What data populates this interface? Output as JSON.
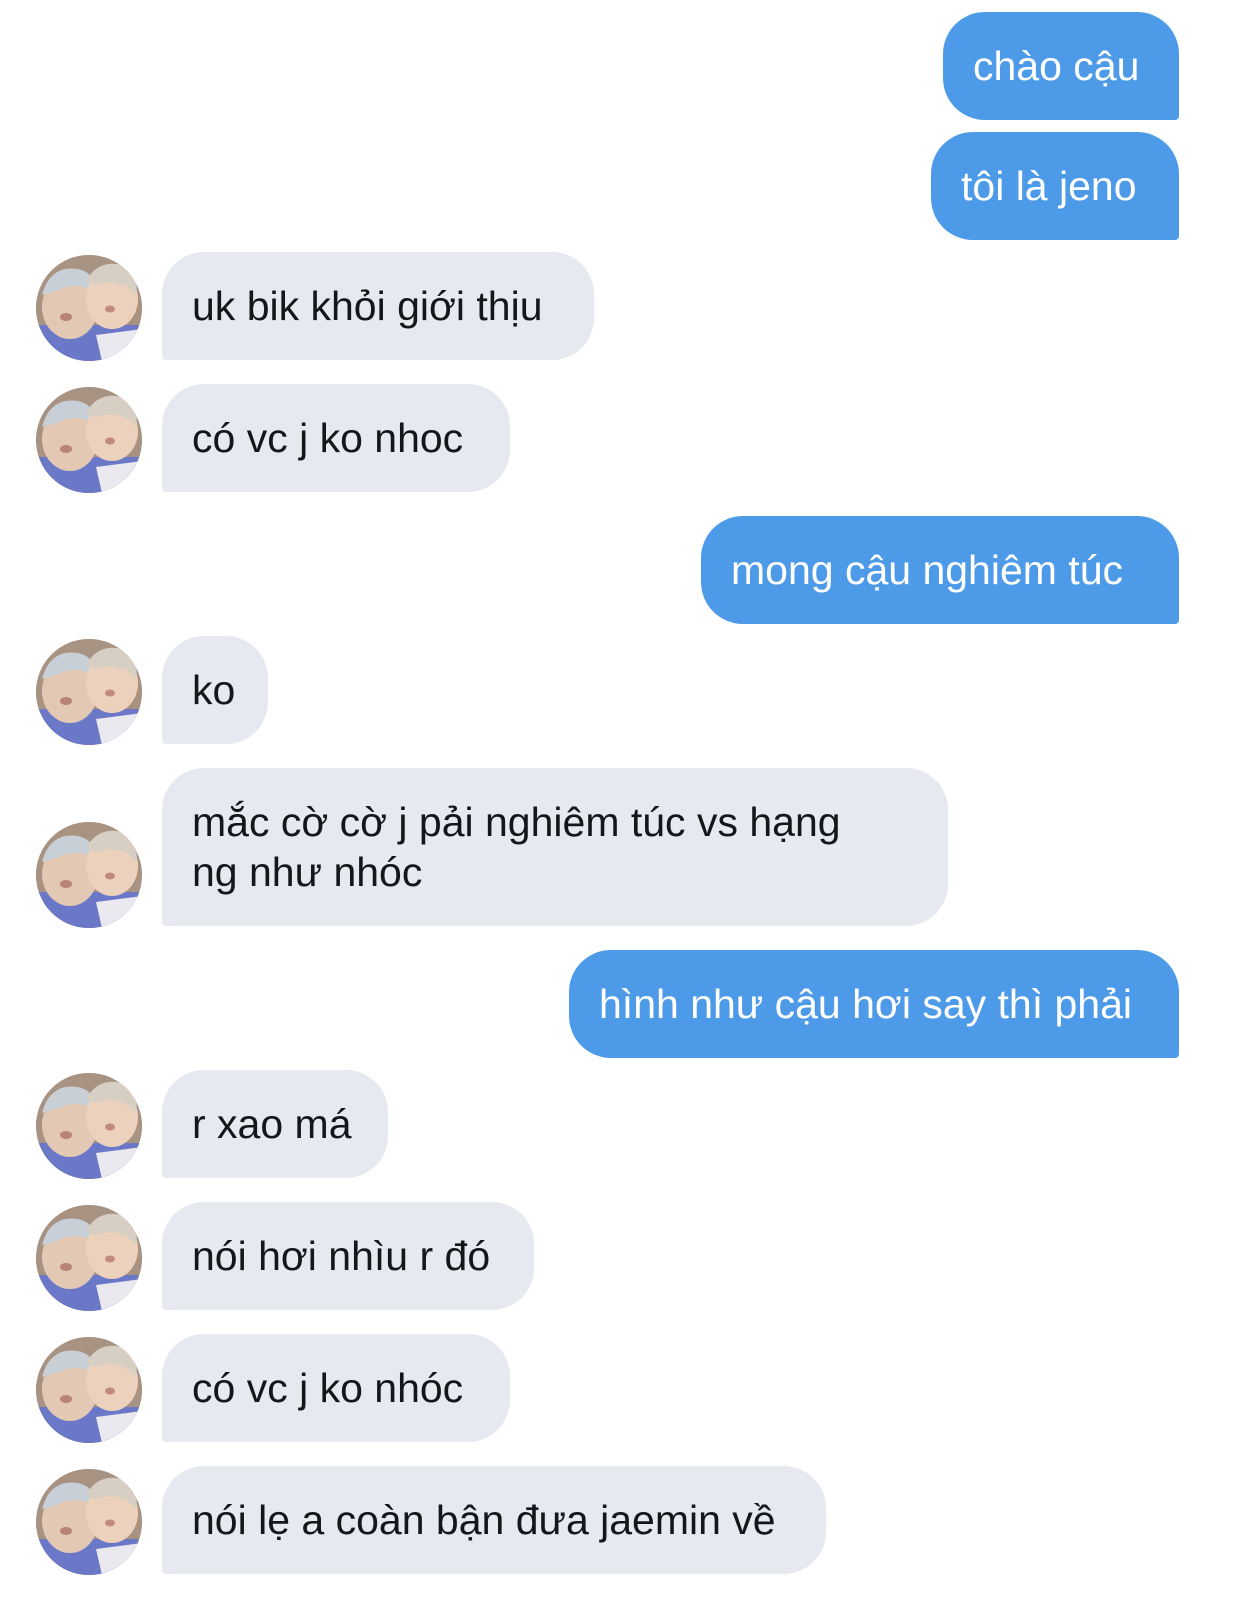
{
  "conversation": {
    "messages": [
      {
        "from": "me",
        "text": "chào cậu"
      },
      {
        "from": "me",
        "text": "tôi là jeno"
      },
      {
        "from": "them",
        "text": "uk bik khỏi giới thịu",
        "avatar_icon": "contact-avatar-photo"
      },
      {
        "from": "them",
        "text": "có vc j ko nhoc",
        "avatar_icon": "contact-avatar-photo"
      },
      {
        "from": "me",
        "text": "mong cậu nghiêm túc"
      },
      {
        "from": "them",
        "text": "ko",
        "avatar_icon": "contact-avatar-photo"
      },
      {
        "from": "them",
        "text": "mắc cờ cờ j pải nghiêm túc vs hạng\nng như nhóc",
        "avatar_icon": "contact-avatar-photo"
      },
      {
        "from": "me",
        "text": "hình như cậu hơi say thì phải"
      },
      {
        "from": "them",
        "text": "r xao má",
        "avatar_icon": "contact-avatar-photo"
      },
      {
        "from": "them",
        "text": "nói hơi nhìu r đó",
        "avatar_icon": "contact-avatar-photo"
      },
      {
        "from": "them",
        "text": "có vc j ko nhóc",
        "avatar_icon": "contact-avatar-photo"
      },
      {
        "from": "them",
        "text": "nói lẹ a coàn bận đưa jaemin về",
        "avatar_icon": "contact-avatar-photo"
      }
    ]
  },
  "colors": {
    "outgoing_bubble": "#4d9be8",
    "incoming_bubble": "#e6e9ef",
    "background": "#ffffff"
  }
}
